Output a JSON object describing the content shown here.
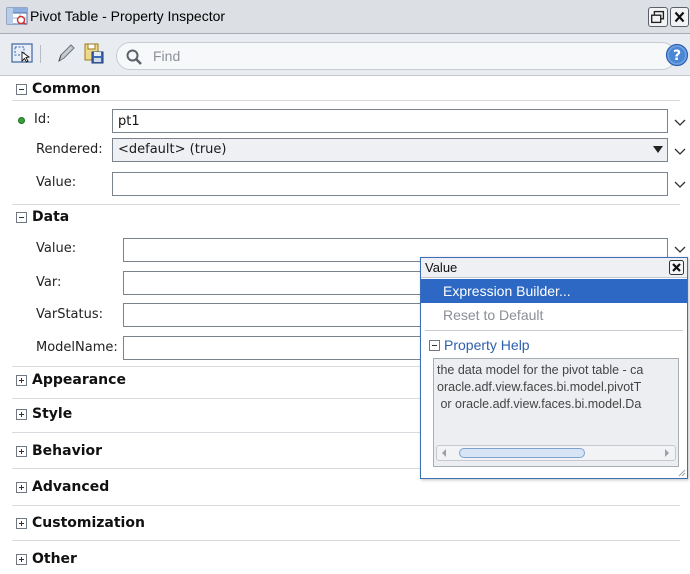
{
  "window": {
    "title": "Pivot Table - Property Inspector"
  },
  "toolbar": {
    "find_placeholder": "Find"
  },
  "sections": {
    "common": "Common",
    "data": "Data",
    "appearance": "Appearance",
    "style": "Style",
    "behavior": "Behavior",
    "advanced": "Advanced",
    "customization": "Customization",
    "other": "Other"
  },
  "common": {
    "id_label": "Id:",
    "id_value": "pt1",
    "rendered_label": "Rendered:",
    "rendered_value": "<default> (true)",
    "value_label": "Value:",
    "value_value": ""
  },
  "data": {
    "value_label": "Value:",
    "var_label": "Var:",
    "varstatus_label": "VarStatus:",
    "modelname_label": "ModelName:"
  },
  "popup": {
    "title": "Value",
    "expression_builder": "Expression Builder...",
    "reset_default": "Reset to Default",
    "help_heading": "Property Help",
    "help_line1": "the data model for the pivot table - ca",
    "help_line2": "oracle.adf.view.faces.bi.model.pivotT",
    "help_line3": " or oracle.adf.view.faces.bi.model.Da"
  },
  "colors": {
    "accent": "#2d68c4",
    "required": "#36a23a"
  }
}
